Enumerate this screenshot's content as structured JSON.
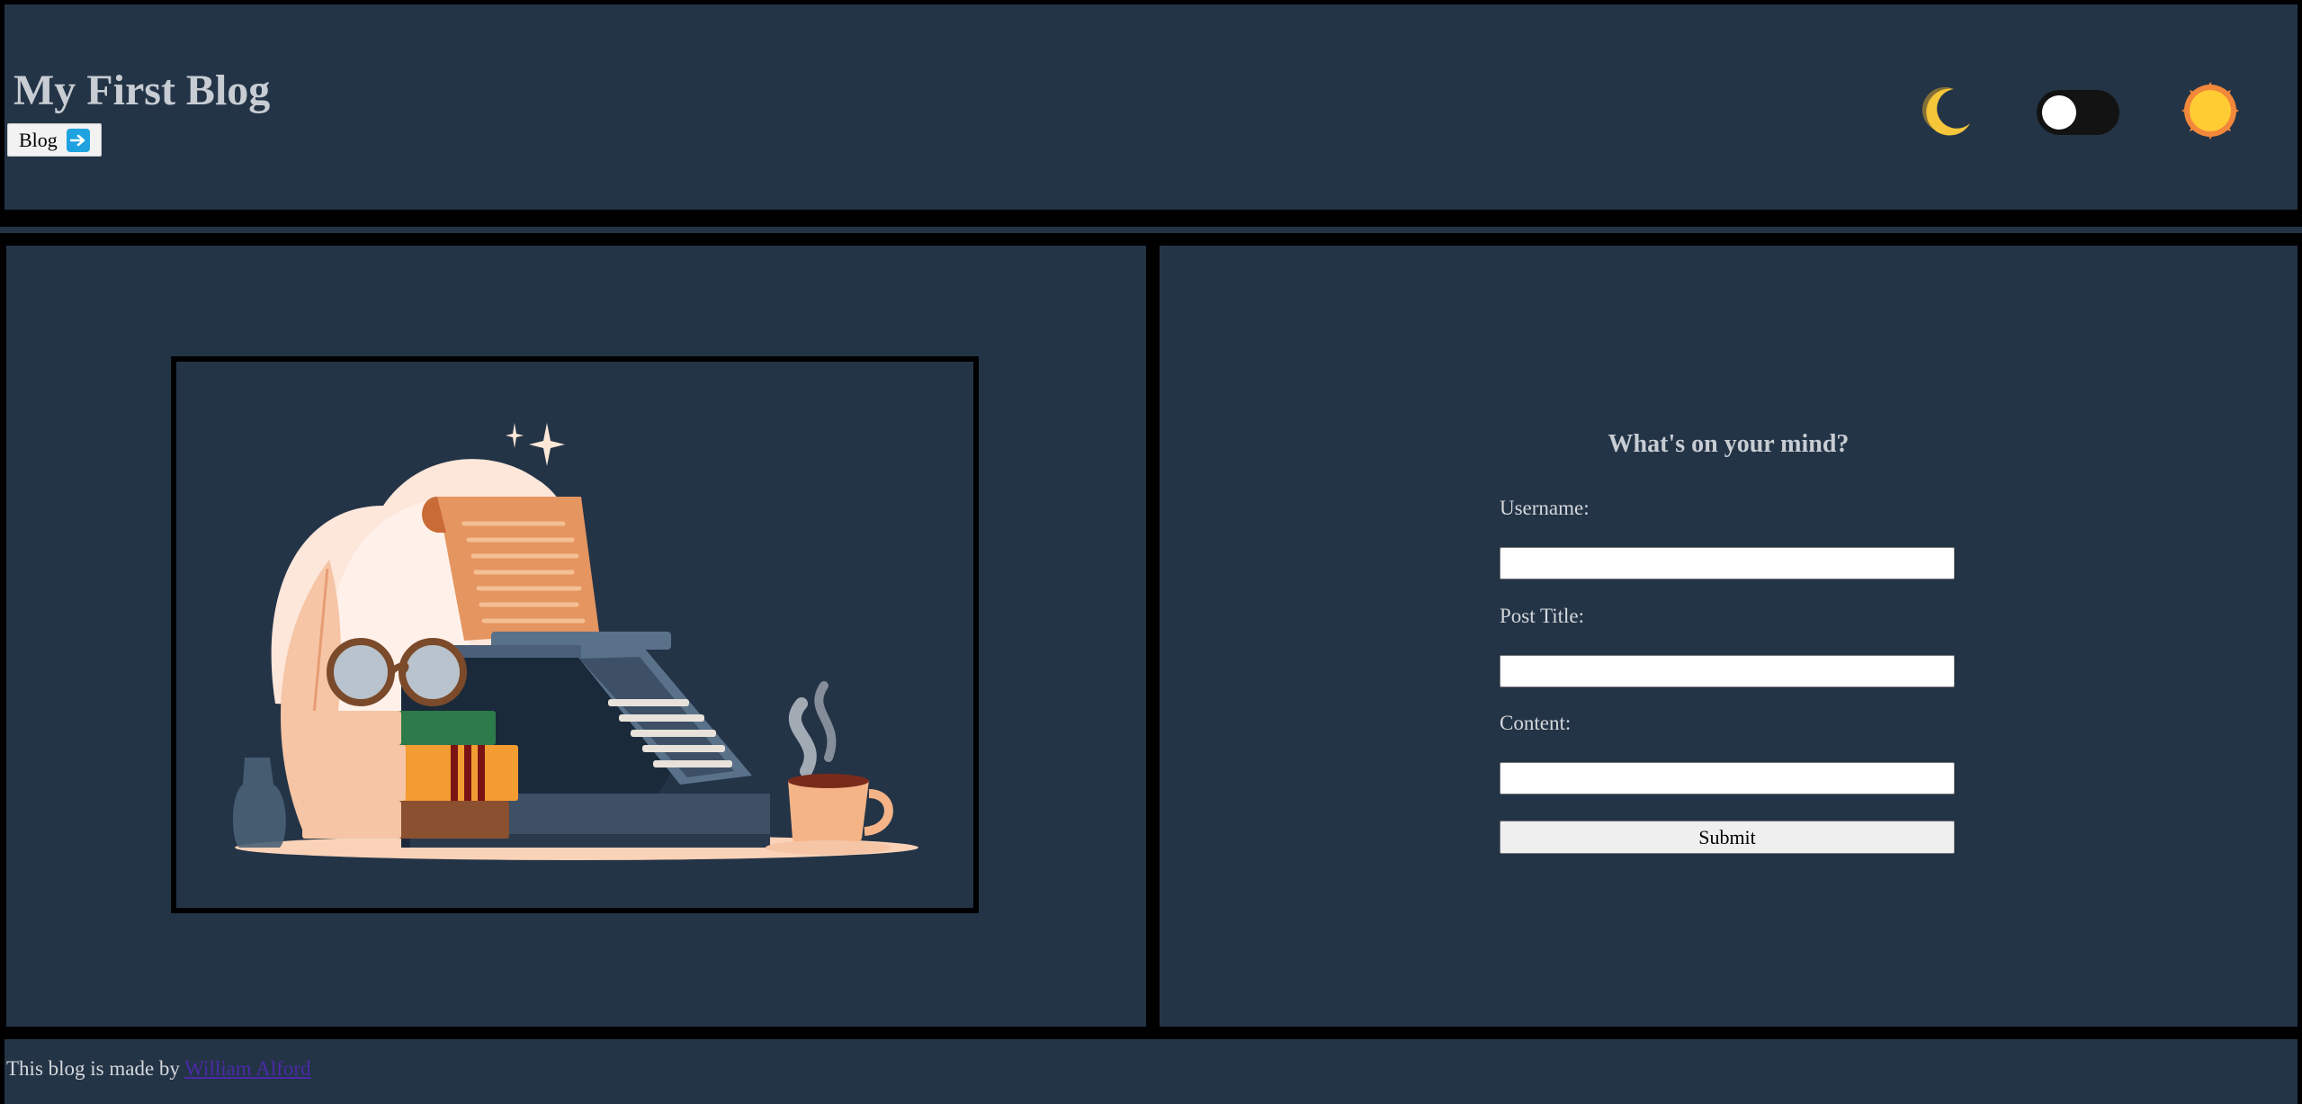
{
  "header": {
    "title": "My First Blog",
    "blog_button_label": "Blog",
    "blog_button_icon": "arrow-right-icon",
    "theme_toggle": {
      "moon_icon": "moon-icon",
      "sun_icon": "sun-icon",
      "state": "off"
    }
  },
  "hero_image": {
    "icon": "typewriter-illustration"
  },
  "form": {
    "heading": "What's on your mind?",
    "username_label": "Username:",
    "username_value": "",
    "post_title_label": "Post Title:",
    "post_title_value": "",
    "content_label": "Content:",
    "content_value": "",
    "submit_label": "Submit"
  },
  "footer": {
    "text": "This blog is made by ",
    "author_link": "William Alford"
  },
  "colors": {
    "background": "#000000",
    "panel": "#243447",
    "text": "#c8cdd3",
    "link": "#4a2aa8",
    "arrow_accent": "#1ea3e0",
    "sun": "#ffcc33",
    "moon": "#f6c63a"
  }
}
